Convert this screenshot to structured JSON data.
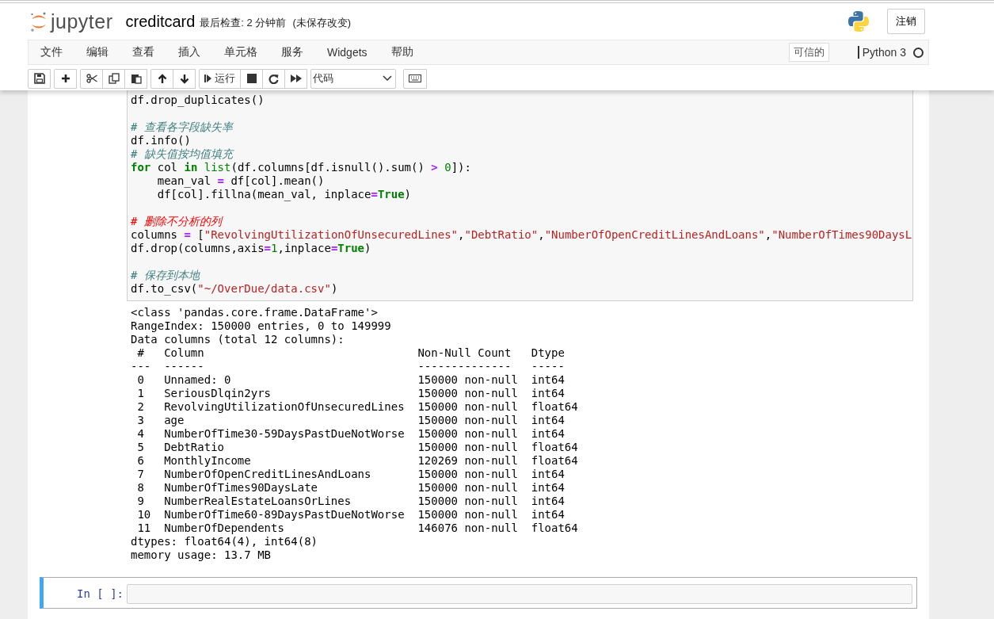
{
  "header": {
    "logo_text": "jupyter",
    "notebook_name": "creditcard",
    "checkpoint": "最后检查: 2 分钟前",
    "autosave": "(未保存改变)",
    "logout": "注销"
  },
  "menu": {
    "items": [
      "文件",
      "编辑",
      "查看",
      "插入",
      "单元格",
      "服务",
      "Widgets",
      "帮助"
    ],
    "trusted": "可信的",
    "kernel_name": "Python 3",
    "kernel_busy": false
  },
  "toolbar": {
    "run_label": "运行",
    "cell_type": "代码"
  },
  "code_cell": {
    "lines": [
      {
        "kind": "code",
        "tokens": [
          {
            "kind": "text",
            "text": "df.drop_duplicates()"
          }
        ]
      },
      {
        "kind": "blank"
      },
      {
        "kind": "code",
        "tokens": [
          {
            "kind": "comment",
            "text": "# 查看各字段缺失率"
          }
        ]
      },
      {
        "kind": "code",
        "tokens": [
          {
            "kind": "text",
            "text": "df.info()"
          }
        ]
      },
      {
        "kind": "code",
        "tokens": [
          {
            "kind": "comment",
            "text": "# 缺失值按均值填充"
          }
        ]
      },
      {
        "kind": "code",
        "tokens": [
          {
            "kind": "keyword",
            "text": "for"
          },
          {
            "kind": "text",
            "text": " col "
          },
          {
            "kind": "keyword",
            "text": "in"
          },
          {
            "kind": "builtin",
            "text": " list"
          },
          {
            "kind": "text",
            "text": "(df.columns[df.isnull().sum() "
          },
          {
            "kind": "operator",
            "text": ">"
          },
          {
            "kind": "number",
            "text": " 0"
          },
          {
            "kind": "text",
            "text": "]):"
          }
        ]
      },
      {
        "kind": "code",
        "tokens": [
          {
            "kind": "text",
            "text": "    mean_val "
          },
          {
            "kind": "operator",
            "text": "="
          },
          {
            "kind": "text",
            "text": " df[col].mean()"
          }
        ]
      },
      {
        "kind": "code",
        "tokens": [
          {
            "kind": "text",
            "text": "    df[col].fillna(mean_val, inplace"
          },
          {
            "kind": "operator",
            "text": "="
          },
          {
            "kind": "keyword",
            "text": "True"
          },
          {
            "kind": "text",
            "text": ")"
          }
        ]
      },
      {
        "kind": "blank"
      },
      {
        "kind": "code",
        "tokens": [
          {
            "kind": "comment_red",
            "text": "# 删除不分析的列"
          }
        ]
      },
      {
        "kind": "code",
        "tokens": [
          {
            "kind": "text",
            "text": "columns "
          },
          {
            "kind": "operator",
            "text": "="
          },
          {
            "kind": "text",
            "text": " ["
          },
          {
            "kind": "string",
            "text": "\"RevolvingUtilizationOfUnsecuredLines\""
          },
          {
            "kind": "text",
            "text": ","
          },
          {
            "kind": "string",
            "text": "\"DebtRatio\""
          },
          {
            "kind": "text",
            "text": ","
          },
          {
            "kind": "string",
            "text": "\"NumberOfOpenCreditLinesAndLoans\""
          },
          {
            "kind": "text",
            "text": ","
          },
          {
            "kind": "string",
            "text": "\"NumberOfTimes90DaysL"
          }
        ]
      },
      {
        "kind": "code",
        "tokens": [
          {
            "kind": "text",
            "text": "df.drop(columns,axis"
          },
          {
            "kind": "operator",
            "text": "="
          },
          {
            "kind": "number",
            "text": "1"
          },
          {
            "kind": "text",
            "text": ",inplace"
          },
          {
            "kind": "operator",
            "text": "="
          },
          {
            "kind": "keyword",
            "text": "True"
          },
          {
            "kind": "text",
            "text": ")"
          }
        ]
      },
      {
        "kind": "blank"
      },
      {
        "kind": "code",
        "tokens": [
          {
            "kind": "comment",
            "text": "# 保存到本地"
          }
        ]
      },
      {
        "kind": "code",
        "tokens": [
          {
            "kind": "text",
            "text": "df.to_csv("
          },
          {
            "kind": "string",
            "text": "\"~/OverDue/data.csv\""
          },
          {
            "kind": "text",
            "text": ")"
          }
        ]
      }
    ]
  },
  "output": {
    "intro": [
      "<class 'pandas.core.frame.DataFrame'>",
      "RangeIndex: 150000 entries, 0 to 149999",
      "Data columns (total 12 columns):"
    ],
    "columns": [
      "#",
      "Column",
      "Non-Null Count",
      "Dtype"
    ],
    "separators": [
      "---",
      "------",
      "--------------",
      "-----"
    ],
    "rows": [
      {
        "index": "0",
        "column": "Unnamed: 0",
        "count": "150000 non-null",
        "dtype": "int64"
      },
      {
        "index": "1",
        "column": "SeriousDlqin2yrs",
        "count": "150000 non-null",
        "dtype": "int64"
      },
      {
        "index": "2",
        "column": "RevolvingUtilizationOfUnsecuredLines",
        "count": "150000 non-null",
        "dtype": "float64"
      },
      {
        "index": "3",
        "column": "age",
        "count": "150000 non-null",
        "dtype": "int64"
      },
      {
        "index": "4",
        "column": "NumberOfTime30-59DaysPastDueNotWorse",
        "count": "150000 non-null",
        "dtype": "int64"
      },
      {
        "index": "5",
        "column": "DebtRatio",
        "count": "150000 non-null",
        "dtype": "float64"
      },
      {
        "index": "6",
        "column": "MonthlyIncome",
        "count": "120269 non-null",
        "dtype": "float64"
      },
      {
        "index": "7",
        "column": "NumberOfOpenCreditLinesAndLoans",
        "count": "150000 non-null",
        "dtype": "int64"
      },
      {
        "index": "8",
        "column": "NumberOfTimes90DaysLate",
        "count": "150000 non-null",
        "dtype": "int64"
      },
      {
        "index": "9",
        "column": "NumberRealEstateLoansOrLines",
        "count": "150000 non-null",
        "dtype": "int64"
      },
      {
        "index": "10",
        "column": "NumberOfTime60-89DaysPastDueNotWorse",
        "count": "150000 non-null",
        "dtype": "int64"
      },
      {
        "index": "11",
        "column": "NumberOfDependents",
        "count": "146076 non-null",
        "dtype": "float64"
      }
    ],
    "footer": [
      "dtypes: float64(4), int64(8)",
      "memory usage: 13.7 MB"
    ]
  },
  "empty_cell": {
    "prompt": "In [ ]:",
    "selected": true
  }
}
